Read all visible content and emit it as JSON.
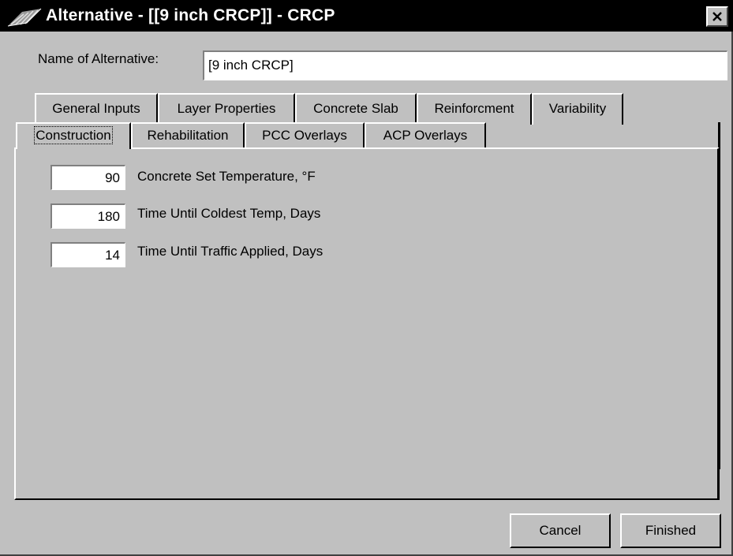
{
  "window": {
    "title": "Alternative - [[9 inch CRCP]] - CRCP",
    "close_glyph": "✕",
    "icon": "app-icon"
  },
  "name_of_alternative": {
    "label": "Name of Alternative:",
    "value": "[9 inch CRCP]"
  },
  "tabs": {
    "row1": [
      {
        "label": "General Inputs"
      },
      {
        "label": "Layer Properties"
      },
      {
        "label": "Concrete Slab"
      },
      {
        "label": "Reinforcment"
      },
      {
        "label": "Variability"
      }
    ],
    "row2": [
      {
        "label": "Construction",
        "active": true
      },
      {
        "label": "Rehabilitation"
      },
      {
        "label": "PCC Overlays"
      },
      {
        "label": "ACP Overlays"
      }
    ]
  },
  "construction": {
    "fields": [
      {
        "value": "90",
        "label": "Concrete Set Temperature, °F"
      },
      {
        "value": "180",
        "label": "Time Until Coldest Temp, Days"
      },
      {
        "value": "14",
        "label": "Time Until Traffic Applied, Days"
      }
    ]
  },
  "buttons": {
    "cancel": "Cancel",
    "finished": "Finished"
  }
}
